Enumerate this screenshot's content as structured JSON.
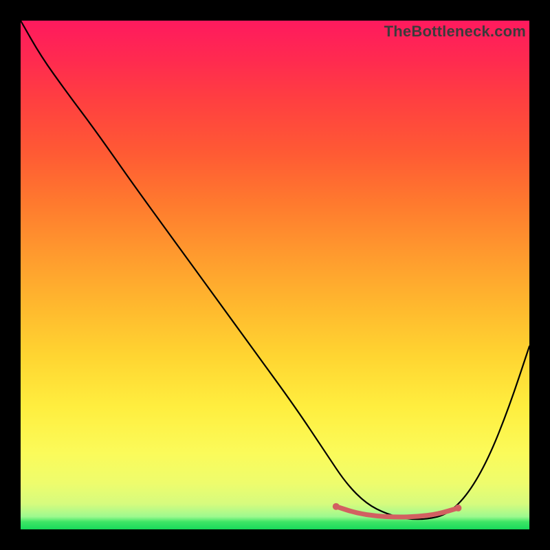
{
  "watermark": "TheBottleneck.com",
  "colors": {
    "background": "#000000",
    "curve": "#000000",
    "accent_curve": "#d26061",
    "gradient_top": "#ff1a5e",
    "gradient_bottom": "#18d95a"
  },
  "chart_data": {
    "type": "line",
    "title": "",
    "xlabel": "",
    "ylabel": "",
    "xlim": [
      0,
      100
    ],
    "ylim": [
      0,
      100
    ],
    "grid": false,
    "note": "Axes are unlabeled; x/y values are normalized 0–100. y is plotted with origin at bottom (so y=0 is the bottom edge).",
    "series": [
      {
        "name": "main-curve",
        "color": "#000000",
        "x": [
          0,
          4,
          9,
          15,
          22,
          30,
          38,
          46,
          54,
          60,
          64,
          68,
          72,
          76,
          80,
          84,
          88,
          92,
          96,
          100
        ],
        "y": [
          100,
          93,
          86,
          78,
          68,
          57,
          46,
          35,
          24,
          15,
          9,
          5,
          3,
          2,
          2,
          3,
          7,
          14,
          24,
          36
        ]
      },
      {
        "name": "accent-segment",
        "color": "#d26061",
        "x": [
          62,
          66,
          70,
          74,
          78,
          82,
          86
        ],
        "y": [
          4.5,
          3.2,
          2.6,
          2.4,
          2.5,
          3.0,
          4.2
        ]
      }
    ],
    "annotations": [
      {
        "type": "point",
        "x": 62,
        "y": 4.5,
        "color": "#d26061"
      },
      {
        "type": "point",
        "x": 86,
        "y": 4.2,
        "color": "#d26061"
      }
    ]
  }
}
